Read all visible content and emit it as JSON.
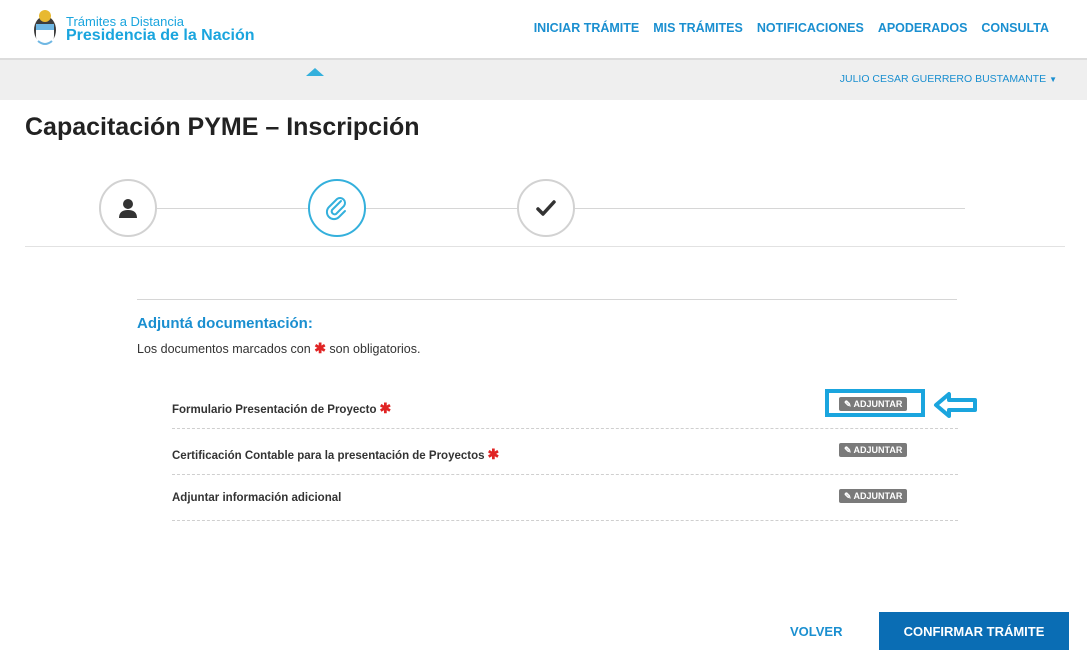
{
  "brand": {
    "line1": "Trámites a Distancia",
    "line2": "Presidencia de la Nación",
    "seal_icon": "argentina-coat-of-arms-icon",
    "color": "#1aa5de"
  },
  "nav": {
    "items": [
      {
        "label": "INICIAR TRÁMITE"
      },
      {
        "label": "MIS TRÁMITES"
      },
      {
        "label": "NOTIFICACIONES"
      },
      {
        "label": "APODERADOS"
      },
      {
        "label": "CONSULTA"
      }
    ]
  },
  "user": {
    "name": "JULIO CESAR GUERRERO BUSTAMANTE",
    "caret_icon": "caret-down-icon"
  },
  "page": {
    "title": "Capacitación PYME – Inscripción"
  },
  "stepper": {
    "steps": [
      {
        "icon": "user-icon",
        "state": "completed"
      },
      {
        "icon": "paperclip-icon",
        "state": "active"
      },
      {
        "icon": "checkmark-icon",
        "state": "pending"
      }
    ],
    "active_color": "#34b0dc"
  },
  "attachments": {
    "title": "Adjuntá documentación:",
    "note_before": "Los documentos marcados con",
    "note_after": "son obligatorios.",
    "required_marker": "✱",
    "button_label": "ADJUNTAR",
    "documents": [
      {
        "label": "Formulario Presentación de Proyecto",
        "required": true
      },
      {
        "label": "Certificación Contable para la presentación de Proyectos",
        "required": true
      },
      {
        "label": "Adjuntar información adicional",
        "required": false
      }
    ],
    "highlight_color": "#1aa5de"
  },
  "actions": {
    "back_label": "VOLVER",
    "confirm_label": "CONFIRMAR TRÁMITE",
    "confirm_color": "#0a6db4"
  }
}
